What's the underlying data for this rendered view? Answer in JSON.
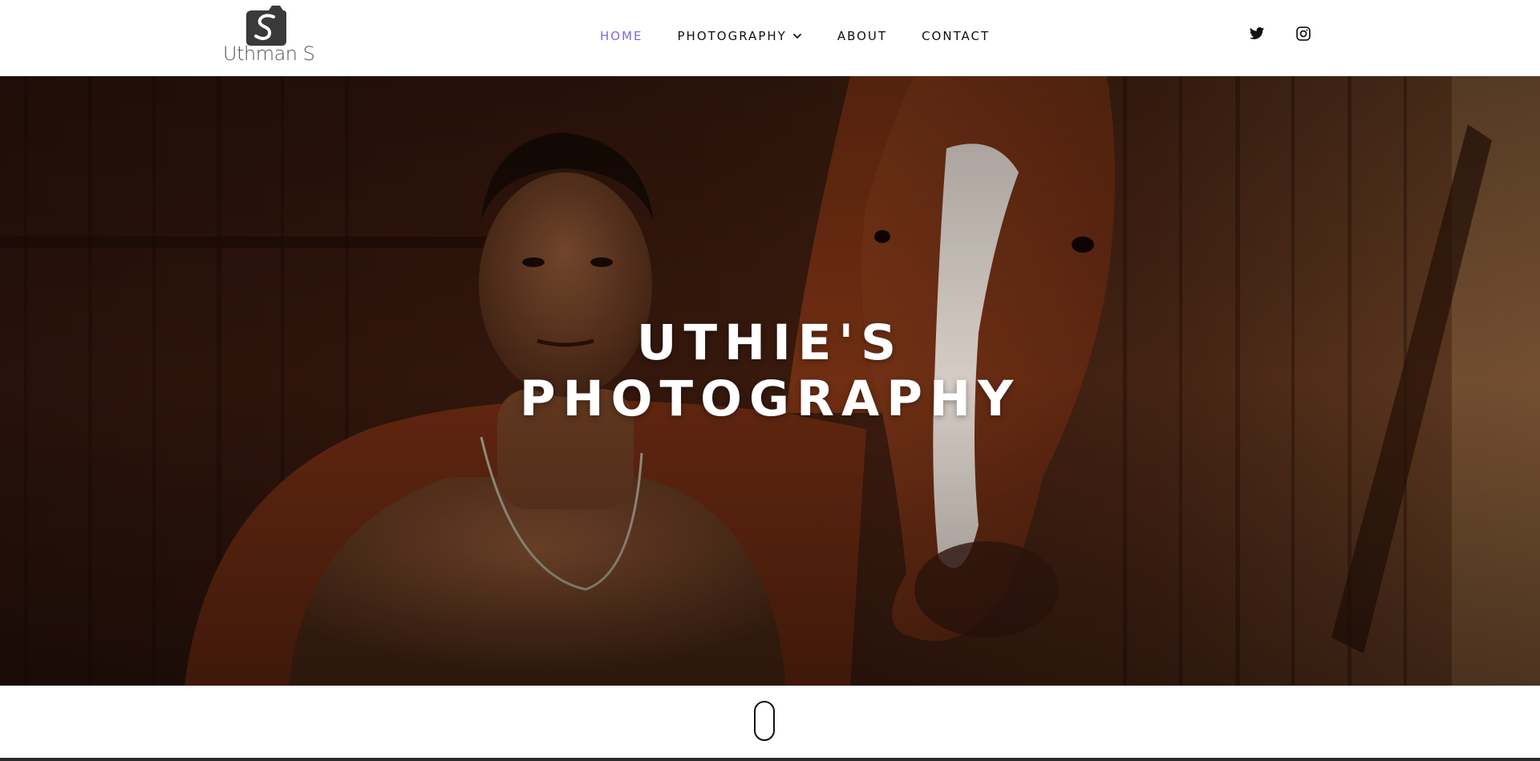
{
  "brand": {
    "logo_text": "Uthman S",
    "logo_icon": "camera-s-logo-icon"
  },
  "nav": {
    "items": [
      {
        "label": "HOME",
        "active": true
      },
      {
        "label": "PHOTOGRAPHY",
        "has_dropdown": true
      },
      {
        "label": "ABOUT"
      },
      {
        "label": "CONTACT"
      }
    ]
  },
  "social": {
    "twitter_icon": "twitter-icon",
    "instagram_icon": "instagram-icon"
  },
  "hero": {
    "title_line1": "UTHIE'S",
    "title_line2": "PHOTOGRAPHY"
  },
  "scroll": {
    "icon": "scroll-mouse-icon"
  },
  "colors": {
    "accent": "#7a6ad8",
    "nav_text": "#111111",
    "logo_gray": "#555555",
    "hero_text": "#ffffff"
  }
}
